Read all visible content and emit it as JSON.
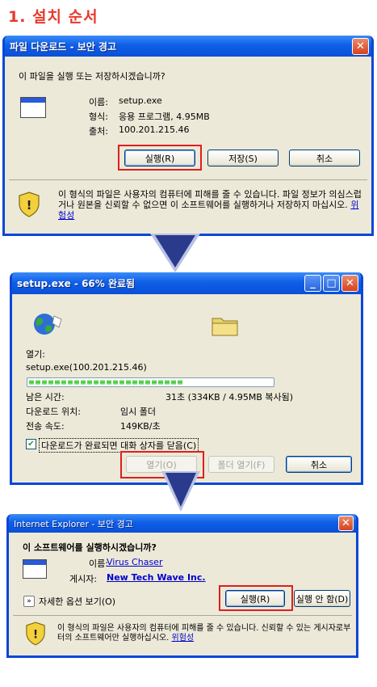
{
  "title": "1. 설치 순서",
  "dialog1": {
    "title": "파일 다운로드 - 보안 경고",
    "question": "이 파일을 실행 또는 저장하시겠습니까?",
    "name_label": "이름:",
    "name_value": "setup.exe",
    "type_label": "형식:",
    "type_value": "응용 프로그램, 4.95MB",
    "from_label": "출처:",
    "from_value": "100.201.215.46",
    "run_label": "실행(R)",
    "save_label": "저장(S)",
    "cancel_label": "취소",
    "warning": "이 형식의 파일은 사용자의 컴퓨터에 피해를 줄 수 있습니다. 파일 정보가 의심스럽거나 원본을 신뢰할 수 없으면 이 소프트웨어를 실행하거나 저장하지 마십시오.",
    "risk_link": "위험성"
  },
  "dialog2": {
    "title": "setup.exe - 66% 완료됨",
    "open_label": "열기:",
    "file_value": "setup.exe(100.201.215.46)",
    "progress_percent": 66,
    "remaining_label": "남은 시간:",
    "remaining_value": "31초 (334KB / 4.95MB 복사됨)",
    "download_to_label": "다운로드 위치:",
    "download_to_value": "임시 폴더",
    "rate_label": "전송 속도:",
    "rate_value": "149KB/초",
    "checkbox_label": "다운로드가 완료되면 대화 상자를 닫음(C)",
    "checkbox_checked": true,
    "open_btn": "열기(O)",
    "open_folder_btn": "폴더 열기(F)",
    "cancel_btn": "취소"
  },
  "dialog3": {
    "title": "Internet Explorer - 보안 경고",
    "question": "이 소프트웨어를 실행하시겠습니까?",
    "name_label": "이름:",
    "name_value": "Virus Chaser",
    "publisher_label": "게시자:",
    "publisher_value": "New Tech Wave Inc.",
    "more_options": "자세한 옵션 보기(O)",
    "run_label": "실행(R)",
    "dont_run_label": "실행 안 함(D)",
    "warning": "이 형식의 파일은 사용자의 컴퓨터에 피해를 줄 수 있습니다. 신뢰할 수 있는 게시자로부터의 소프트웨어만 실행하십시오.",
    "risk_link": "위험성"
  },
  "colors": {
    "title_red": "#e8392b",
    "xp_blue": "#0a47d6",
    "highlight_red": "#e01e1e",
    "arrow_navy": "#2a3a8c"
  }
}
